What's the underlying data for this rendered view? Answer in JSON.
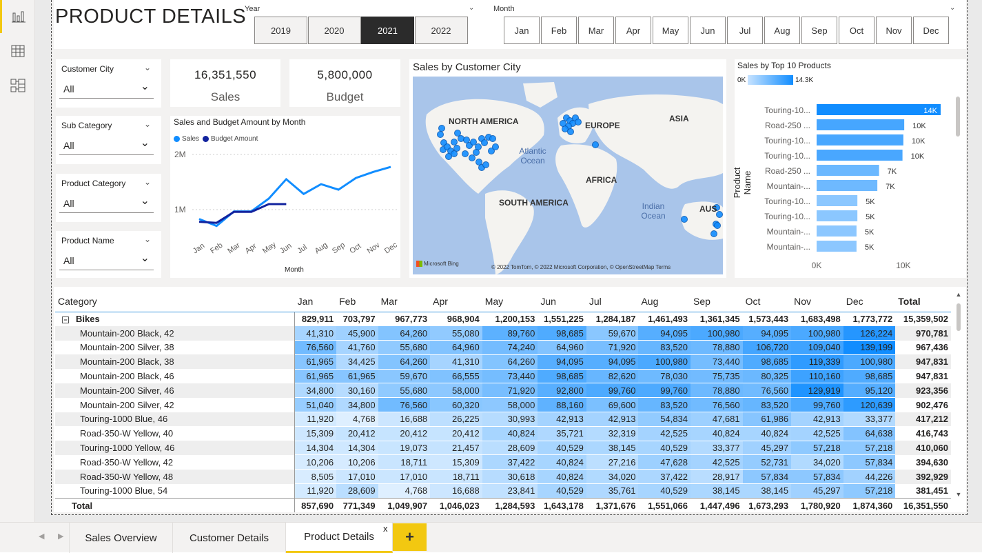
{
  "header": {
    "title": "PRODUCT DETAILS"
  },
  "year_slicer": {
    "label": "Year",
    "options": [
      "2019",
      "2020",
      "2021",
      "2022"
    ],
    "selected": "2021"
  },
  "month_slicer": {
    "label": "Month",
    "options": [
      "Jan",
      "Feb",
      "Mar",
      "Apr",
      "May",
      "Jun",
      "Jul",
      "Aug",
      "Sep",
      "Oct",
      "Nov",
      "Dec"
    ]
  },
  "filters": [
    {
      "label": "Customer City",
      "value": "All"
    },
    {
      "label": "Sub Category",
      "value": "All"
    },
    {
      "label": "Product Category",
      "value": "All"
    },
    {
      "label": "Product Name",
      "value": "All"
    }
  ],
  "kpis": {
    "sales_value": "16,351,550",
    "sales_label": "Sales",
    "budget_value": "5,800,000",
    "budget_label": "Budget"
  },
  "line_chart": {
    "title": "Sales and Budget Amount by Month",
    "legend": [
      "Sales",
      "Budget Amount"
    ],
    "xlabel": "Month"
  },
  "map": {
    "title": "Sales by Customer City",
    "labels": {
      "na": "NORTH AMERICA",
      "eu": "EUROPE",
      "asia": "ASIA",
      "af": "AFRICA",
      "sa": "SOUTH AMERICA",
      "aus": "AUS",
      "atl": "Atlantic Ocean",
      "ind": "Indian Ocean"
    },
    "bing": "Microsoft Bing",
    "credits": "© 2022 TomTom, © 2022 Microsoft Corporation, © OpenStreetMap  Terms"
  },
  "bar_chart": {
    "title": "Sales by Top 10 Products",
    "scale_min": "0K",
    "scale_max": "14.3K",
    "ylabel": "Product Name",
    "x_ticks": [
      "0K",
      "10K"
    ]
  },
  "chart_data": [
    {
      "type": "line",
      "title": "Sales and Budget Amount by Month",
      "categories": [
        "Jan",
        "Feb",
        "Mar",
        "Apr",
        "May",
        "Jun",
        "Jul",
        "Aug",
        "Sep",
        "Oct",
        "Nov",
        "Dec"
      ],
      "xlabel": "Month",
      "y_ticks": [
        "2M",
        "1M"
      ],
      "ylim": [
        0,
        2300000
      ],
      "series": [
        {
          "name": "Sales",
          "color": "#118dff",
          "values": [
            829911,
            703797,
            967773,
            968904,
            1200153,
            1551225,
            1284187,
            1461493,
            1361345,
            1573443,
            1683498,
            1773772
          ]
        },
        {
          "name": "Budget Amount",
          "color": "#12239e",
          "values": [
            780000,
            760000,
            960000,
            960000,
            1100000,
            1100000
          ]
        }
      ]
    },
    {
      "type": "bar",
      "title": "Sales by Top 10 Products",
      "xlabel": "",
      "ylabel": "Product Name",
      "categories": [
        "Touring-10...",
        "Road-250 ...",
        "Touring-10...",
        "Touring-10...",
        "Road-250 ...",
        "Mountain-...",
        "Touring-10...",
        "Touring-10...",
        "Mountain-...",
        "Mountain-..."
      ],
      "values": [
        14300,
        10100,
        10000,
        9900,
        7200,
        7000,
        4700,
        4700,
        4600,
        4600
      ],
      "labels": [
        "14K",
        "10K",
        "10K",
        "10K",
        "7K",
        "7K",
        "5K",
        "5K",
        "5K",
        "5K"
      ],
      "xlim": [
        0,
        14300
      ]
    }
  ],
  "matrix": {
    "headers": [
      "Category",
      "Jan",
      "Feb",
      "Mar",
      "Apr",
      "May",
      "Jun",
      "Jul",
      "Aug",
      "Sep",
      "Oct",
      "Nov",
      "Dec",
      "Total"
    ],
    "group": {
      "label": "Bikes",
      "values": [
        "829,911",
        "703,797",
        "967,773",
        "968,904",
        "1,200,153",
        "1,551,225",
        "1,284,187",
        "1,461,493",
        "1,361,345",
        "1,573,443",
        "1,683,498",
        "1,773,772",
        "15,359,502"
      ]
    },
    "rows": [
      {
        "name": "Mountain-200 Black, 42",
        "values": [
          "41,310",
          "45,900",
          "64,260",
          "55,080",
          "89,760",
          "98,685",
          "59,670",
          "94,095",
          "100,980",
          "94,095",
          "100,980",
          "126,224"
        ],
        "total": "970,781"
      },
      {
        "name": "Mountain-200 Silver, 38",
        "values": [
          "76,560",
          "41,760",
          "55,680",
          "64,960",
          "74,240",
          "64,960",
          "71,920",
          "83,520",
          "78,880",
          "106,720",
          "109,040",
          "139,199"
        ],
        "total": "967,436"
      },
      {
        "name": "Mountain-200 Black, 38",
        "values": [
          "61,965",
          "34,425",
          "64,260",
          "41,310",
          "64,260",
          "94,095",
          "94,095",
          "100,980",
          "73,440",
          "98,685",
          "119,339",
          "100,980"
        ],
        "total": "947,831"
      },
      {
        "name": "Mountain-200 Black, 46",
        "values": [
          "61,965",
          "61,965",
          "59,670",
          "66,555",
          "73,440",
          "98,685",
          "82,620",
          "78,030",
          "75,735",
          "80,325",
          "110,160",
          "98,685"
        ],
        "total": "947,831"
      },
      {
        "name": "Mountain-200 Silver, 46",
        "values": [
          "34,800",
          "30,160",
          "55,680",
          "58,000",
          "71,920",
          "92,800",
          "99,760",
          "99,760",
          "78,880",
          "76,560",
          "129,919",
          "95,120"
        ],
        "total": "923,356"
      },
      {
        "name": "Mountain-200 Silver, 42",
        "values": [
          "51,040",
          "34,800",
          "76,560",
          "60,320",
          "58,000",
          "88,160",
          "69,600",
          "83,520",
          "76,560",
          "83,520",
          "99,760",
          "120,639"
        ],
        "total": "902,476"
      },
      {
        "name": "Touring-1000 Blue, 46",
        "values": [
          "11,920",
          "4,768",
          "16,688",
          "26,225",
          "30,993",
          "42,913",
          "42,913",
          "54,834",
          "47,681",
          "61,986",
          "42,913",
          "33,377"
        ],
        "total": "417,212"
      },
      {
        "name": "Road-350-W Yellow, 40",
        "values": [
          "15,309",
          "20,412",
          "20,412",
          "20,412",
          "40,824",
          "35,721",
          "32,319",
          "42,525",
          "40,824",
          "40,824",
          "42,525",
          "64,638"
        ],
        "total": "416,743"
      },
      {
        "name": "Touring-1000 Yellow, 46",
        "values": [
          "14,304",
          "14,304",
          "19,073",
          "21,457",
          "28,609",
          "40,529",
          "38,145",
          "40,529",
          "33,377",
          "45,297",
          "57,218",
          "57,218"
        ],
        "total": "410,060"
      },
      {
        "name": "Road-350-W Yellow, 42",
        "values": [
          "10,206",
          "10,206",
          "18,711",
          "15,309",
          "37,422",
          "40,824",
          "27,216",
          "47,628",
          "42,525",
          "52,731",
          "34,020",
          "57,834"
        ],
        "total": "394,630"
      },
      {
        "name": "Road-350-W Yellow, 48",
        "values": [
          "8,505",
          "17,010",
          "17,010",
          "18,711",
          "30,618",
          "40,824",
          "34,020",
          "37,422",
          "28,917",
          "57,834",
          "57,834",
          "44,226"
        ],
        "total": "392,929"
      },
      {
        "name": "Touring-1000 Blue, 54",
        "values": [
          "11,920",
          "28,609",
          "4,768",
          "16,688",
          "23,841",
          "40,529",
          "35,761",
          "40,529",
          "38,145",
          "38,145",
          "45,297",
          "57,218"
        ],
        "total": "381,451"
      }
    ],
    "total": {
      "label": "Total",
      "values": [
        "857,690",
        "771,349",
        "1,049,907",
        "1,046,023",
        "1,284,593",
        "1,643,178",
        "1,371,676",
        "1,551,066",
        "1,447,496",
        "1,673,293",
        "1,780,920",
        "1,874,360",
        "16,351,550"
      ]
    }
  },
  "tabs": [
    {
      "label": "Sales Overview"
    },
    {
      "label": "Customer Details"
    },
    {
      "label": "Product Details"
    }
  ],
  "tab_close": "x",
  "tab_add": "+"
}
